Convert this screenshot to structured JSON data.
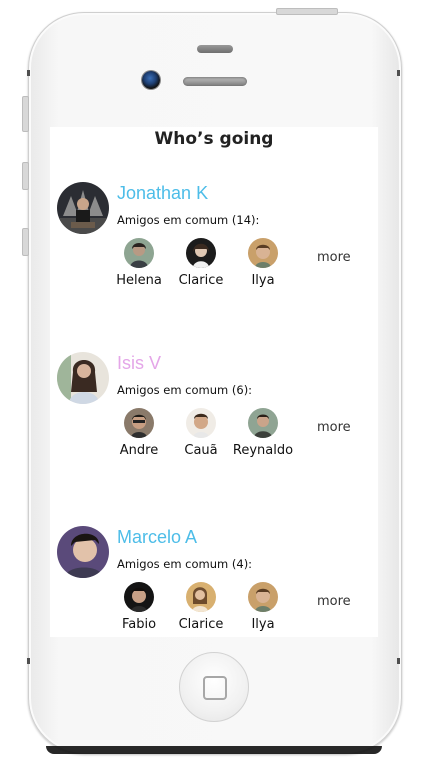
{
  "screen": {
    "title": "Who’s going"
  },
  "colors": {
    "name_blue": "#4dbde8",
    "name_pink": "#e4a6e8"
  },
  "people": [
    {
      "name": "Jonathan K",
      "name_color": "#4dbde8",
      "mutual_label": "Amigos em comum (14):",
      "friends": [
        "Helena",
        "Clarice",
        "Ilya"
      ],
      "more_label": "more"
    },
    {
      "name": "Isis V",
      "name_color": "#e4a6e8",
      "mutual_label": "Amigos em comum (6):",
      "friends": [
        "Andre",
        "Cauã",
        "Reynaldo"
      ],
      "more_label": "more"
    },
    {
      "name": "Marcelo A",
      "name_color": "#4dbde8",
      "mutual_label": "Amigos em comum (4):",
      "friends": [
        "Fabio",
        "Clarice",
        "Ilya"
      ],
      "more_label": "more"
    }
  ]
}
